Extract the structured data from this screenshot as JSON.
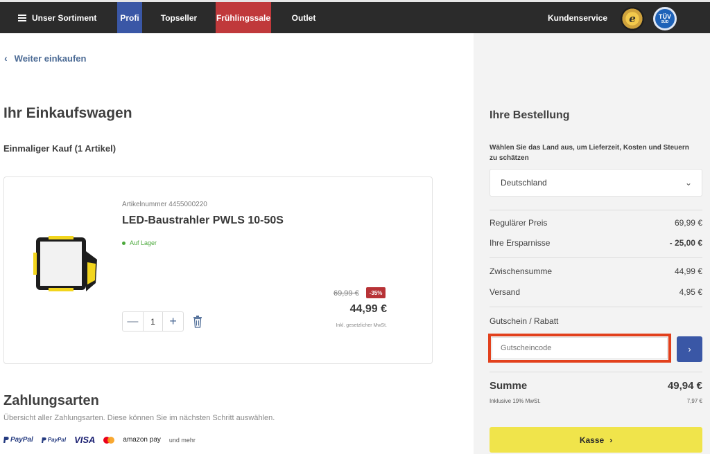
{
  "nav": {
    "menu_label": "Unser Sortiment",
    "items": [
      "Profi",
      "Topseller",
      "Frühlingssale",
      "Outlet"
    ],
    "service_label": "Kundenservice",
    "badge_trusted": "e",
    "badge_tuv_top": "TÜV",
    "badge_tuv_bottom": "SÜD",
    "colors": {
      "bar": "#2b2b2b",
      "profi": "#3a57a6",
      "sale": "#c0393b"
    }
  },
  "cart": {
    "back_label": "Weiter einkaufen",
    "title": "Ihr Einkaufswagen",
    "subtitle": "Einmaliger Kauf (1 Artikel)",
    "item": {
      "article_number": "Artikelnummer 4455000220",
      "name": "LED-Baustrahler PWLS 10-50S",
      "stock": "Auf Lager",
      "quantity": "1",
      "old_price": "69,99 €",
      "discount": "-35%",
      "price": "44,99 €",
      "vat_note": "Inkl. gesetzlicher MwSt."
    }
  },
  "payment": {
    "title": "Zahlungsarten",
    "description": "Übersicht aller Zahlungsarten. Diese können Sie im nächsten Schritt auswählen.",
    "logos": [
      "PayPal",
      "PayPal",
      "VISA",
      "mastercard",
      "amazon pay"
    ],
    "more": "und mehr"
  },
  "order": {
    "title": "Ihre Bestellung",
    "country_label": "Wählen Sie das Land aus, um Lieferzeit, Kosten und Steuern zu schätzen",
    "country_value": "Deutschland",
    "regular_price_label": "Regulärer Preis",
    "regular_price": "69,99 €",
    "savings_label": "Ihre Ersparnisse",
    "savings": "- 25,00 €",
    "subtotal_label": "Zwischensumme",
    "subtotal": "44,99 €",
    "shipping_label": "Versand",
    "shipping": "4,95 €",
    "voucher_label": "Gutschein / Rabatt",
    "voucher_placeholder": "Gutscheincode",
    "total_label": "Summe",
    "total": "49,94 €",
    "tax_label": "Inklusive 19% MwSt.",
    "tax": "7,97 €",
    "checkout_label": "Kasse",
    "colors": {
      "checkout": "#f0e44b",
      "voucher_highlight": "#e2401c",
      "accent": "#3a57a6"
    }
  }
}
